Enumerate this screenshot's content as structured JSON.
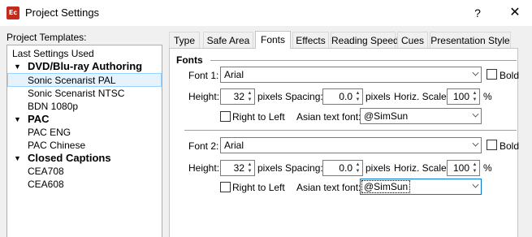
{
  "window": {
    "icon": "Ec",
    "title": "Project Settings",
    "help": "?",
    "close": "✕"
  },
  "templates": {
    "label": "Project Templates:",
    "items": [
      {
        "label": "Last Settings Used",
        "type": "item",
        "indent": 0
      },
      {
        "label": "DVD/Blu-ray Authoring",
        "type": "group"
      },
      {
        "label": "Sonic Scenarist PAL",
        "type": "item",
        "indent": 1,
        "selected": true
      },
      {
        "label": "Sonic Scenarist NTSC",
        "type": "item",
        "indent": 1
      },
      {
        "label": "BDN 1080p",
        "type": "item",
        "indent": 1
      },
      {
        "label": "PAC",
        "type": "group"
      },
      {
        "label": "PAC ENG",
        "type": "item",
        "indent": 1
      },
      {
        "label": "PAC Chinese",
        "type": "item",
        "indent": 1
      },
      {
        "label": "Closed Captions",
        "type": "group"
      },
      {
        "label": "CEA708",
        "type": "item",
        "indent": 1
      },
      {
        "label": "CEA608",
        "type": "item",
        "indent": 1
      }
    ]
  },
  "tabs": [
    "Type",
    "Safe Area",
    "Fonts",
    "Effects",
    "Reading Speed",
    "Cues",
    "Presentation Style"
  ],
  "active_tab": "Fonts",
  "fonts": {
    "heading": "Fonts",
    "font1": {
      "label": "Font 1:",
      "value": "Arial",
      "bold_label": "Bold",
      "height_label": "Height:",
      "height": "32",
      "height_unit": "pixels",
      "spacing_label": "Spacing:",
      "spacing": "0.0",
      "spacing_unit": "pixels",
      "scale_label": "Horiz. Scale:",
      "scale": "100",
      "scale_unit": "%",
      "rtl_label": "Right to Left",
      "asian_label": "Asian text font:",
      "asian_value": "@SimSun"
    },
    "font2": {
      "label": "Font 2:",
      "value": "Arial",
      "bold_label": "Bold",
      "height_label": "Height:",
      "height": "32",
      "height_unit": "pixels",
      "spacing_label": "Spacing:",
      "spacing": "0.0",
      "spacing_unit": "pixels",
      "scale_label": "Horiz. Scale:",
      "scale": "100",
      "scale_unit": "%",
      "rtl_label": "Right to Left",
      "asian_label": "Asian text font:",
      "asian_value": "@SimSun"
    }
  }
}
